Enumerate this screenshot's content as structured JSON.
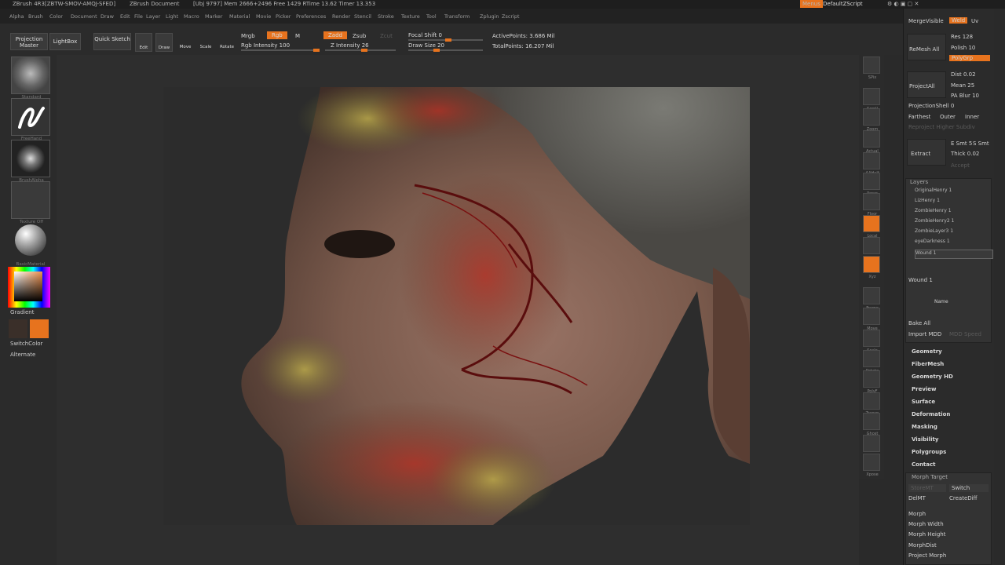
{
  "titlebar": {
    "app": "ZBrush 4R3[ZBTW-SMOV-AMQJ-SFED]",
    "doc": "ZBrush Document",
    "stats": "[Ubj 9797]  Mem 2666+2496 Free 1429 RTime 13.62 Timer 13.353",
    "menus_label": "Menus",
    "script_label": "DefaultZScript"
  },
  "menubar": [
    "Alpha",
    "Brush",
    "Color",
    "Document",
    "Draw",
    "Edit",
    "File",
    "Layer",
    "Light",
    "Macro",
    "Marker",
    "Material",
    "Movie",
    "Picker",
    "Preferences",
    "Render",
    "Stencil",
    "Stroke",
    "Texture",
    "Tool",
    "Transform",
    "Zplugin",
    "Zscript"
  ],
  "toolbar": {
    "projection_master": "Projection Master",
    "lightbox": "LightBox",
    "quick_sketch": "Quick Sketch",
    "edit": "Edit",
    "draw": "Draw",
    "move": "Move",
    "scale": "Scale",
    "rotate": "Rotate",
    "mrgb": "Mrgb",
    "rgb": "Rgb",
    "m": "M",
    "rgb_intensity": "Rgb Intensity 100",
    "zadd": "Zadd",
    "zsub": "Zsub",
    "zcut": "Zcut",
    "z_intensity": "Z Intensity 26",
    "focal_shift": "Focal Shift 0",
    "draw_size": "Draw Size 20",
    "active_points": "ActivePoints: 3.686 Mil",
    "total_points": "TotalPoints: 16.207 Mil"
  },
  "left": {
    "brush": "Standard",
    "stroke": "FreeHand",
    "alpha": "BrushAlpha",
    "texture": "Texture Off",
    "material": "BasicMaterial",
    "gradient": "Gradient",
    "switchcolor": "SwitchColor",
    "alternate": "Alternate"
  },
  "rightshelf": [
    "SPix",
    "Scroll",
    "Zoom",
    "Actual",
    "AAHalf",
    "Persp",
    "Floor",
    "Local",
    "L.Sym",
    "Xyz",
    "Frame",
    "Move",
    "Scale",
    "Rotate",
    "PolyF",
    "Transp",
    "Ghost",
    "Solo",
    "Xpose"
  ],
  "tray": {
    "mergevisible": "MergeVisible",
    "weld": "Weld",
    "uv": "Uv",
    "remesh_all": "ReMesh All",
    "res": "Res 128",
    "polish": "Polish 10",
    "polygrp": "PolyGrp",
    "project_all": "ProjectAll",
    "dist": "Dist 0.02",
    "mean": "Mean 25",
    "pa_blur": "PA Blur 10",
    "projection_shell": "ProjectionShell 0",
    "farthest": "Farthest",
    "outer": "Outer",
    "inner": "Inner",
    "reproject": "Reproject Higher Subdiv",
    "extract": "Extract",
    "e_smt": "E Smt 5",
    "s_smt": "S Smt",
    "thick": "Thick 0.02",
    "accept": "Accept",
    "layers_header": "Layers",
    "layers": [
      "OriginalHenry 1",
      "LizHenry 1",
      "ZombieHenry 1",
      "ZombieHenry2 1",
      "ZombieLayer3 1",
      "eyeDarkness 1",
      "Wound 1"
    ],
    "current_layer": "Wound 1",
    "name": "Name",
    "bake_all": "Bake All",
    "import_mdd": "Import MDD",
    "mdd_speed": "MDD Speed",
    "sections": [
      "Geometry",
      "FiberMesh",
      "Geometry HD",
      "Preview",
      "Surface",
      "Deformation",
      "Masking",
      "Visibility",
      "Polygroups",
      "Contact"
    ],
    "morph_target": "Morph Target",
    "storemt": "StoreMT",
    "switch": "Switch",
    "delmt": "DelMT",
    "createdriff": "CreateDiff",
    "morph": "Morph",
    "morph_width": "Morph Width",
    "morph_height": "Morph Height",
    "morph_dist": "MorphDist",
    "project_morph": "Project Morph"
  },
  "colors": {
    "accent": "#e7731e",
    "bg": "#2b2b2b"
  }
}
